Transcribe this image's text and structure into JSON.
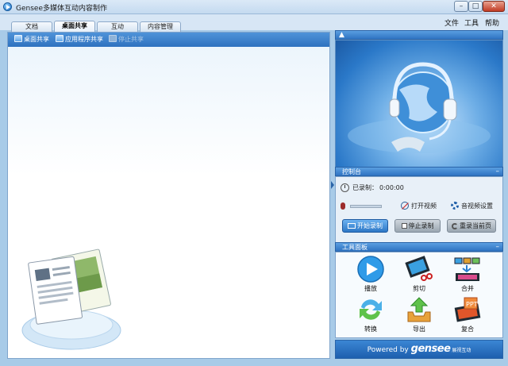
{
  "window": {
    "title": "Gensee多媒体互动内容制作",
    "controls": {
      "minimize": "–",
      "maximize": "□",
      "close": "✕"
    }
  },
  "menu": [
    "文件",
    "工具",
    "帮助"
  ],
  "tabs": [
    {
      "label": "文档",
      "active": false
    },
    {
      "label": "桌面共享",
      "active": true
    },
    {
      "label": "互动",
      "active": false
    },
    {
      "label": "内容管理",
      "active": false
    }
  ],
  "toolbar": {
    "desktop_share": "桌面共享",
    "app_share": "应用程序共享",
    "stop_share": "停止共享"
  },
  "video_panel": {
    "collapse": "▲"
  },
  "control_panel": {
    "title": "控制台",
    "collapse": "–",
    "recorded_label": "已录制：",
    "recorded_time": "0:00:00",
    "open_video": "打开视频",
    "av_settings": "音视频设置",
    "start_record": "开始录制",
    "stop_record": "停止录制",
    "rerecord": "重录当前页"
  },
  "tools_panel": {
    "title": "工具面板",
    "collapse": "–",
    "items": [
      {
        "label": "播放",
        "icon": "play-icon"
      },
      {
        "label": "剪切",
        "icon": "film-scissors-icon"
      },
      {
        "label": "合并",
        "icon": "merge-icon"
      },
      {
        "label": "转换",
        "icon": "convert-icon"
      },
      {
        "label": "导出",
        "icon": "export-icon"
      },
      {
        "label": "复合",
        "icon": "ppt-film-icon"
      }
    ]
  },
  "brand": {
    "powered": "Powered by",
    "name": "gensee",
    "sub": "展视互动"
  },
  "colors": {
    "accent": "#2f74c2",
    "panel_border": "#7fa4cc",
    "background": "#a8cbe8"
  }
}
